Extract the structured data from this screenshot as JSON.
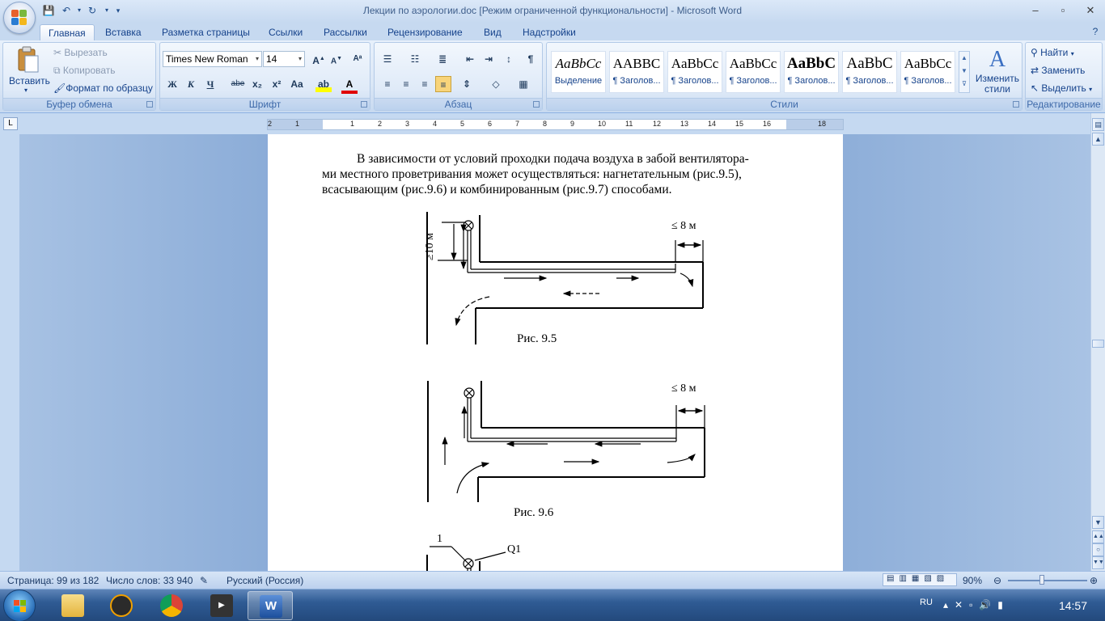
{
  "window": {
    "title": "Лекции по аэрологии.doc [Режим ограниченной функциональности] - Microsoft Word"
  },
  "tabs": [
    "Главная",
    "Вставка",
    "Разметка страницы",
    "Ссылки",
    "Рассылки",
    "Рецензирование",
    "Вид",
    "Надстройки"
  ],
  "clipboard": {
    "paste": "Вставить",
    "cut": "Вырезать",
    "copy": "Копировать",
    "format_painter": "Формат по образцу",
    "label": "Буфер обмена"
  },
  "font": {
    "name": "Times New Roman",
    "size": "14",
    "label": "Шрифт",
    "bold": "Ж",
    "italic": "К",
    "underline": "Ч",
    "strike": "abe",
    "subscript": "x₂",
    "superscript": "x²",
    "case": "Aa"
  },
  "paragraph": {
    "label": "Абзац"
  },
  "styles": {
    "label": "Стили",
    "items": [
      {
        "sample": "AaBbCc",
        "name": "Выделение"
      },
      {
        "sample": "AABBC",
        "name": "¶ Заголов..."
      },
      {
        "sample": "AaBbCc",
        "name": "¶ Заголов..."
      },
      {
        "sample": "AaBbCc",
        "name": "¶ Заголов..."
      },
      {
        "sample": "AaBbC",
        "name": "¶ Заголов..."
      },
      {
        "sample": "AaBbC",
        "name": "¶ Заголов..."
      },
      {
        "sample": "AaBbCc",
        "name": "¶ Заголов..."
      }
    ],
    "change": "Изменить стили"
  },
  "editing": {
    "find": "Найти",
    "replace": "Заменить",
    "select": "Выделить",
    "label": "Редактирование"
  },
  "document": {
    "paragraph_lines": [
      "В зависимости от условий проходки подача воздуха в забой вентилятора-",
      "ми местного проветривания может осуществляться: нагнетательным (рис.9.5),",
      "всасывающим (рис.9.6) и комбинированным (рис.9.7) способами."
    ],
    "fig1_caption": "Рис. 9.5",
    "fig2_caption": "Рис. 9.6",
    "dim_top": "≥10 м",
    "dim_end": "≤ 8 м",
    "fig3_label_1": "1",
    "fig3_label_q": "Q1"
  },
  "ruler": {
    "corner": "L",
    "ticks": [
      "2",
      "1",
      "",
      "1",
      "2",
      "3",
      "4",
      "5",
      "6",
      "7",
      "8",
      "9",
      "10",
      "11",
      "12",
      "13",
      "14",
      "15",
      "16",
      "",
      "18"
    ]
  },
  "statusbar": {
    "page": "Страница: 99 из 182",
    "words": "Число слов: 33 940",
    "language": "Русский (Россия)",
    "zoom": "90%"
  },
  "taskbar": {
    "lang": "RU",
    "time": "14:57"
  }
}
